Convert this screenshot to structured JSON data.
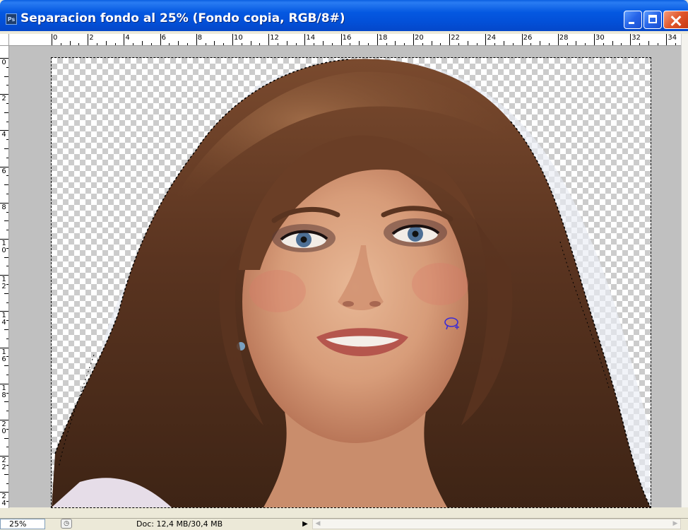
{
  "window": {
    "title": "Separacion fondo al 25% (Fondo copia, RGB/8#)",
    "app_icon_label": "Ps"
  },
  "rulers": {
    "horizontal_labels": [
      "0",
      "2",
      "4",
      "6",
      "8",
      "10",
      "12",
      "14",
      "16",
      "18",
      "20",
      "22",
      "24",
      "26",
      "28",
      "30",
      "32",
      "34"
    ],
    "vertical_labels": [
      "0",
      "2",
      "4",
      "6",
      "8",
      "10",
      "12",
      "14",
      "16",
      "18",
      "20",
      "22",
      "24"
    ]
  },
  "canvas": {
    "content": "photo-layer-with-transparency",
    "selection": "marching-ants"
  },
  "cursor": {
    "icon": "lasso-add-cursor-icon"
  },
  "status": {
    "zoom": "25%",
    "doc_info": "Doc: 12,4 MB/30,4 MB",
    "arrow": "▶"
  },
  "colors": {
    "titlebar": "#0458e1",
    "workspace": "#c0c0c0",
    "close_button": "#e0552a"
  }
}
